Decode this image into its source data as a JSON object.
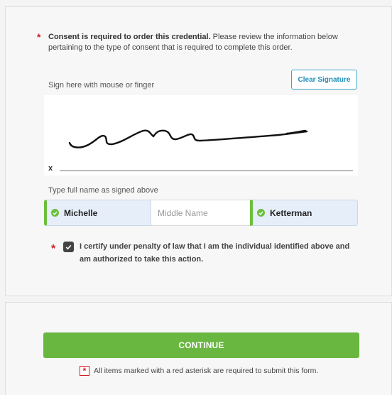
{
  "consent": {
    "required_mark": "*",
    "bold_text": "Consent is required to order this credential.",
    "body_text": " Please review the information below pertaining to the type of consent that is required to complete this order."
  },
  "signature": {
    "label": "Sign here with mouse or finger",
    "clear_button": "Clear Signature",
    "x_mark": "x"
  },
  "name": {
    "label": "Type full name as signed above",
    "first": "Michelle",
    "middle_placeholder": "Middle Name",
    "middle_value": "",
    "last": "Ketterman"
  },
  "certify": {
    "required_mark": "*",
    "checked": true,
    "text": "I certify under penalty of law that I am the individual identified above and am authorized to take this action."
  },
  "footer": {
    "continue_button": "CONTINUE",
    "required_mark": "*",
    "note": "All items marked with a red asterisk are required to submit this form."
  },
  "colors": {
    "accent_green": "#69b641",
    "required_red": "#d0202a",
    "link_blue": "#1f8fb9"
  }
}
